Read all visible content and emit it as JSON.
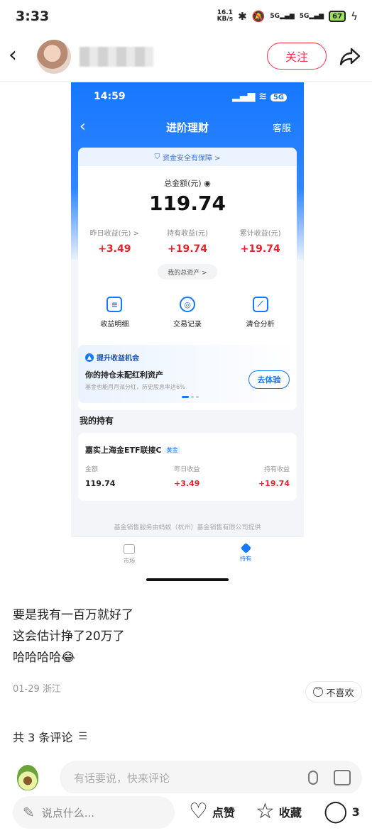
{
  "status_bar": {
    "time": "3:33",
    "speed_top": "16.1",
    "speed_unit": "KB/s",
    "signal1": "5G",
    "signal2": "5G",
    "battery": "67"
  },
  "header": {
    "follow_label": "关注"
  },
  "screenshot": {
    "status_time": "14:59",
    "status_signal": "5G",
    "nav_title": "进阶理财",
    "service_label": "客服",
    "safe_banner": "资金安全有保障 >",
    "total_label": "总金额(元)",
    "total_value": "119.74",
    "stats": [
      {
        "label": "昨日收益(元) >",
        "value": "+3.49"
      },
      {
        "label": "持有收益(元)",
        "value": "+19.74"
      },
      {
        "label": "累计收益(元)",
        "value": "+19.74"
      }
    ],
    "assets_button": "我的总资产 >",
    "tools": [
      {
        "label": "收益明细",
        "icon": "list-icon"
      },
      {
        "label": "交易记录",
        "icon": "record-icon"
      },
      {
        "label": "清仓分析",
        "icon": "chart-icon"
      }
    ],
    "promo": {
      "tag": "提升收益机会",
      "title": "你的持仓未配红利资产",
      "subtitle": "基金也能月月派分红，历史股息率达6%",
      "button": "去体验"
    },
    "my_holdings_title": "我的持有",
    "fund": {
      "name": "嘉实上海金ETF联接C",
      "tag": "黄金",
      "amount_label": "金额",
      "amount": "119.74",
      "yesterday_label": "昨日收益",
      "yesterday": "+3.49",
      "holding_label": "持有收益",
      "holding": "+19.74"
    },
    "provider": "基金销售服务由蚂蚁（杭州）基金销售有限公司提供",
    "tabs": [
      {
        "label": "市场"
      },
      {
        "label": "持有"
      }
    ]
  },
  "post": {
    "line1": "要是我有一百万就好了",
    "line2": "这会估计挣了20万了",
    "line3": "哈哈哈哈😂",
    "date_location": "01-29 浙江",
    "dislike_label": "不喜欢"
  },
  "comments": {
    "count_label": "共 3 条评论",
    "input_placeholder": "有话要说，快来评论"
  },
  "bottom_bar": {
    "say_placeholder": "说点什么...",
    "like_label": "点赞",
    "collect_label": "收藏",
    "comment_count": "3"
  },
  "colors": {
    "accent_red": "#ff2e4d",
    "alipay_blue": "#1677ff",
    "gain_red": "#e3242b"
  }
}
